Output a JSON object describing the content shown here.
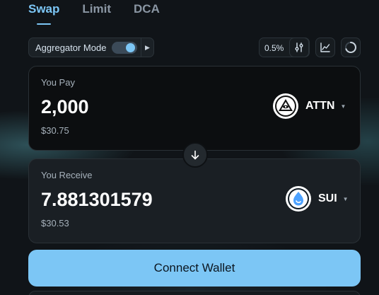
{
  "tabs": [
    {
      "label": "Swap",
      "active": true
    },
    {
      "label": "Limit",
      "active": false
    },
    {
      "label": "DCA",
      "active": false
    }
  ],
  "aggregator": {
    "label": "Aggregator Mode",
    "enabled": true
  },
  "slippage": {
    "value": "0.5%"
  },
  "icons": {
    "settings": "sliders-icon",
    "chart": "chart-line-icon",
    "refresh": "refresh-spinner-icon",
    "swap": "arrow-down-icon"
  },
  "pay": {
    "label": "You Pay",
    "amount": "2,000",
    "usd": "$30.75",
    "token": {
      "symbol": "ATTN",
      "icon": "attn-logo-icon"
    }
  },
  "receive": {
    "label": "You Receive",
    "amount": "7.881301579",
    "usd": "$30.53",
    "token": {
      "symbol": "SUI",
      "icon": "sui-logo-icon"
    }
  },
  "connect_button": {
    "label": "Connect Wallet"
  },
  "colors": {
    "accent": "#7cc6f5",
    "background": "#101418",
    "card_pay": "#0c0e10",
    "card_receive": "#1a1f24"
  }
}
